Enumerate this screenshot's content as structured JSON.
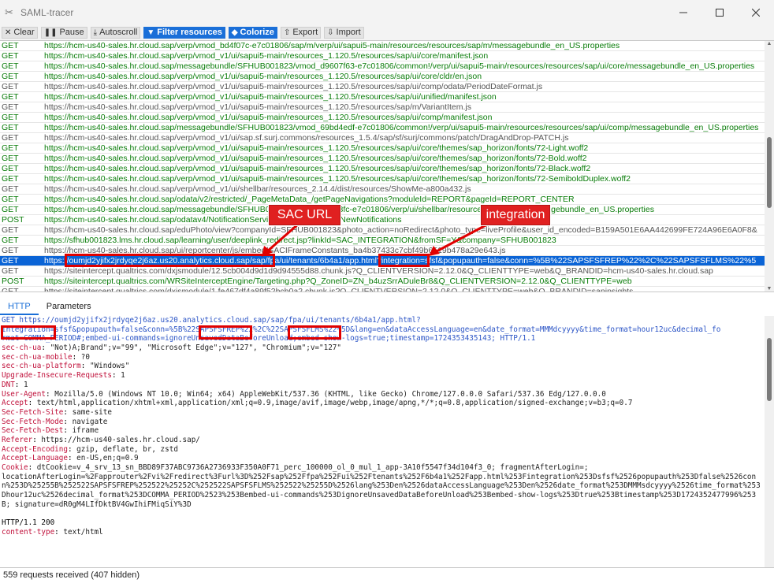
{
  "window": {
    "title": "SAML-tracer"
  },
  "toolbar": {
    "clear": "Clear",
    "pause": "Pause",
    "autoscroll": "Autoscroll",
    "filter": "Filter resources",
    "colorize": "Colorize",
    "export": "Export",
    "import": "Import"
  },
  "requests": [
    {
      "m": "GET",
      "u": "https://hcm-us40-sales.hr.cloud.sap/verp/vmod_bd4f07c-e7c01806/sap/m/verp/ui/sapui5-main/resources/resources/sap/m/messagebundle_en_US.properties",
      "c": "green"
    },
    {
      "m": "GET",
      "u": "https://hcm-us40-sales.hr.cloud.sap/verp/vmod_v1/ui/sapui5-main/resources_1.120.5/resources/sap/ui/core/manifest.json",
      "c": "green"
    },
    {
      "m": "GET",
      "u": "https://hcm-us40-sales.hr.cloud.sap/messagebundle/SFHUB001823/vmod_d9607f63-e7c01806/common!/verp/ui/sapui5-main/resources/resources/sap/ui/core/messagebundle_en_US.properties",
      "c": "green"
    },
    {
      "m": "GET",
      "u": "https://hcm-us40-sales.hr.cloud.sap/verp/vmod_v1/ui/sapui5-main/resources_1.120.5/resources/sap/ui/core/cldr/en.json",
      "c": "green"
    },
    {
      "m": "GET",
      "u": "https://hcm-us40-sales.hr.cloud.sap/verp/vmod_v1/ui/sapui5-main/resources_1.120.5/resources/sap/ui/comp/odata/PeriodDateFormat.js",
      "c": "gray"
    },
    {
      "m": "GET",
      "u": "https://hcm-us40-sales.hr.cloud.sap/verp/vmod_v1/ui/sapui5-main/resources_1.120.5/resources/sap/ui/unified/manifest.json",
      "c": "green"
    },
    {
      "m": "GET",
      "u": "https://hcm-us40-sales.hr.cloud.sap/verp/vmod_v1/ui/sapui5-main/resources_1.120.5/resources/sap/m/VariantItem.js",
      "c": "gray"
    },
    {
      "m": "GET",
      "u": "https://hcm-us40-sales.hr.cloud.sap/verp/vmod_v1/ui/sapui5-main/resources_1.120.5/resources/sap/ui/comp/manifest.json",
      "c": "green"
    },
    {
      "m": "GET",
      "u": "https://hcm-us40-sales.hr.cloud.sap/messagebundle/SFHUB001823/vmod_69bd4edf-e7c01806/common!/verp/ui/sapui5-main/resources/resources/sap/ui/comp/messagebundle_en_US.properties",
      "c": "green"
    },
    {
      "m": "GET",
      "u": "https://hcm-us40-sales.hr.cloud.sap/verp/vmod_v1/ui/sap.sf.surj.commons/resources_1.5.4/sap/sf/surj/commons/patch/DragAndDrop-PATCH.js",
      "c": "gray"
    },
    {
      "m": "GET",
      "u": "https://hcm-us40-sales.hr.cloud.sap/verp/vmod_v1/ui/sapui5-main/resources_1.120.5/resources/sap/ui/core/themes/sap_horizon/fonts/72-Light.woff2",
      "c": "green"
    },
    {
      "m": "GET",
      "u": "https://hcm-us40-sales.hr.cloud.sap/verp/vmod_v1/ui/sapui5-main/resources_1.120.5/resources/sap/ui/core/themes/sap_horizon/fonts/72-Bold.woff2",
      "c": "green"
    },
    {
      "m": "GET",
      "u": "https://hcm-us40-sales.hr.cloud.sap/verp/vmod_v1/ui/sapui5-main/resources_1.120.5/resources/sap/ui/core/themes/sap_horizon/fonts/72-Black.woff2",
      "c": "green"
    },
    {
      "m": "GET",
      "u": "https://hcm-us40-sales.hr.cloud.sap/verp/vmod_v1/ui/sapui5-main/resources_1.120.5/resources/sap/ui/core/themes/sap_horizon/fonts/72-SemiboldDuplex.woff2",
      "c": "green"
    },
    {
      "m": "GET",
      "u": "https://hcm-us40-sales.hr.cloud.sap/verp/vmod_v1/ui/shellbar/resources_2.14.4/dist/resources/ShowMe-a800a432.js",
      "c": "gray"
    },
    {
      "m": "GET",
      "u": "https://hcm-us40-sales.hr.cloud.sap/odata/v2/restricted/_PageMetaData_/getPageNavigations?moduleId=REPORT&pageId=REPORT_CENTER",
      "c": "green"
    },
    {
      "m": "GET",
      "u": "https://hcm-us40-sales.hr.cloud.sap/messagebundle/SFHUB001823/vmod_d53e3fc-e7c01806/verp/ui/shellbar/resources/resources/messagebundle_en_US.properties",
      "c": "green"
    },
    {
      "m": "POST",
      "u": "https://hcm-us40-sales.hr.cloud.sap/odatav4/NotificationService/v1/getNumberOfNewNotifications",
      "c": "green"
    },
    {
      "m": "GET",
      "u": "https://hcm-us40-sales.hr.cloud.sap/eduPhoto/view?companyId=SFHUB001823&photo_action=noRedirect&photo_type=liveProfile&user_id_encoded=B159A501E6AA442699FE724A96E6A0F8&",
      "c": "gray"
    },
    {
      "m": "GET",
      "u": "https://sfhub001823.lms.hr.cloud.sap/learning/user/deeplink_redirect.jsp?linkId=SAC_INTEGRATION&fromSF=Y&company=SFHUB001823",
      "c": "green"
    },
    {
      "m": "GET",
      "u": "https://hcm-us40-sales.hr.cloud.sap/ui/reportcenter/js/embed/SACIFrameConstants_ba4b37433c7cbf49b6519b478a29e643.js",
      "c": "gray"
    },
    {
      "m": "GET",
      "u": "https://oumjd2yjifx2jrdyqe2j6az.us20.analytics.cloud.sap/sap/fpa/ui/tenants/6b4a1/app.html?integration=sfsf&popupauth=false&conn=%5B%22SAPSFSFREP%22%2C%22SAPSFSFLMS%22%5",
      "c": "sel"
    },
    {
      "m": "GET",
      "u": "https://siteintercept.qualtrics.com/dxjsmodule/12.5cb004d9d1d9d94555d88.chunk.js?Q_CLIENTVERSION=2.12.0&Q_CLIENTTYPE=web&Q_BRANDID=hcm-us40-sales.hr.cloud.sap",
      "c": "gray"
    },
    {
      "m": "POST",
      "u": "https://siteintercept.qualtrics.com/WRSiteInterceptEngine/Targeting.php?Q_ZoneID=ZN_b4uzSrrADuleBr8&Q_CLIENTVERSION=2.12.0&Q_CLIENTTYPE=web",
      "c": "green"
    },
    {
      "m": "GET",
      "u": "https://siteintercept.qualtrics.com/dxjsmodule/1.fe467df4a89f52bcb0a2.chunk.js?Q_CLIENTVERSION=2.12.0&Q_CLIENTTYPE=web&Q_BRANDID=sapinsights",
      "c": "gray"
    }
  ],
  "tabs": {
    "http": "HTTP",
    "params": "Parameters"
  },
  "detail": {
    "line1": "GET https://oumjd2yjifx2jrdyqe2j6az.us20.analytics.cloud.sap/sap/fpa/ui/tenants/6b4a1/app.html?",
    "line2": "integration=sfsf&popupauth=false&conn=%5B%22SAPSFSFREP%22%2C%22SAPSFSFLMS%22%5D&lang=en&dataAccessLanguage=en&date_format=MMMdcyyyy&time_format=hour12uc&decimal_fo",
    "line3": "rmat=COMMA_PERIOD#;embed-ui-commands=ignoreUnsavedDataBeforeUnload;embed-show-logs=true;timestamp=1724353435143; HTTP/1.1",
    "headers": [
      {
        "k": "sec-ch-ua",
        "v": " \"Not)A;Brand\";v=\"99\", \"Microsoft Edge\";v=\"127\", \"Chromium\";v=\"127\""
      },
      {
        "k": "sec-ch-ua-mobile",
        "v": " ?0"
      },
      {
        "k": "sec-ch-ua-platform",
        "v": " \"Windows\""
      },
      {
        "k": "Upgrade-Insecure-Requests",
        "v": " 1"
      },
      {
        "k": "DNT",
        "v": " 1"
      },
      {
        "k": "User-Agent",
        "v": " Mozilla/5.0 (Windows NT 10.0; Win64; x64) AppleWebKit/537.36 (KHTML, like Gecko) Chrome/127.0.0.0 Safari/537.36 Edg/127.0.0.0"
      },
      {
        "k": "Accept",
        "v": " text/html,application/xhtml+xml,application/xml;q=0.9,image/avif,image/webp,image/apng,*/*;q=0.8,application/signed-exchange;v=b3;q=0.7"
      },
      {
        "k": "Sec-Fetch-Site",
        "v": " same-site"
      },
      {
        "k": "Sec-Fetch-Mode",
        "v": " navigate"
      },
      {
        "k": "Sec-Fetch-Dest",
        "v": " iframe"
      },
      {
        "k": "Referer",
        "v": " https://hcm-us40-sales.hr.cloud.sap/"
      },
      {
        "k": "Accept-Encoding",
        "v": " gzip, deflate, br, zstd"
      },
      {
        "k": "Accept-Language",
        "v": " en-US,en;q=0.9"
      }
    ],
    "cookie_key": "Cookie",
    "cookie_val": " dtCookie=v_4_srv_13_sn_BBD89F37ABC9736A2736933F350A0F71_perc_100000_ol_0_mul_1_app-3A10f5547f34d104f3_0; fragmentAfterLogin=;\nlocationAfterLogin=%2Fapprouter%2Fvi%2Fredirect%3Furl%3D%252Fsap%252Ffpa%252Fui%252Ftenants%252F6b4a1%252Fapp.html%253Fintegration%253Dsfsf%2526popupauth%253Dfalse%2526conn%253D%25255B%252522SAPSFSFREP%252522%25252C%252522SAPSFSFLMS%252522%25255D%2526lang%253Den%2526dataAccessLanguage%253Den%2526date_format%253DMMMsdcyyyy%2526time_format%253Dhour12uc%2526decimal_format%253DCOMMA_PERIOD%2523%253Bembed-ui-commands%253DignoreUnsavedDataBeforeUnload%253Bembed-show-logs%253Dtrue%253Btimestamp%253D1724352477996%253B; signature=dR0gM4LIfDktBV4GwIhiFMiqSiY%3D",
    "resp_status": "HTTP/1.1 200",
    "resp_key": "content-type",
    "resp_val": " text/html"
  },
  "status": "559 requests received (407 hidden)",
  "annotations": {
    "sac_url": "SAC URL",
    "integration": "integration"
  },
  "colors": {
    "accent": "#1a6fd8",
    "callout": "#e02020",
    "get_green": "#097c09",
    "selected": "#0a64d6",
    "header_key": "#c0103a"
  }
}
